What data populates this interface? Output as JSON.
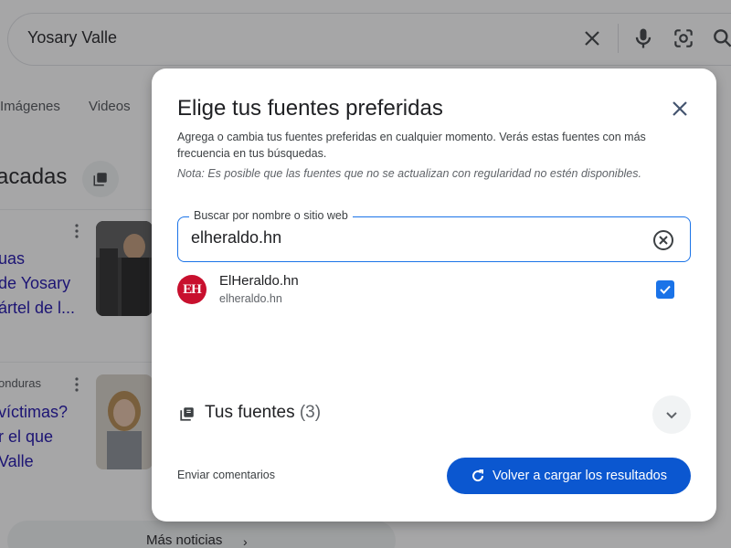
{
  "search": {
    "query": "Yosary Valle"
  },
  "background": {
    "tabs": [
      "Imágenes",
      "Videos"
    ],
    "heading": "acadas",
    "news1_lines": [
      "uas",
      "de Yosary",
      "ártel de l..."
    ],
    "news2_source": "onduras",
    "news2_lines": [
      "víctimas?",
      "r el que",
      "Valle"
    ],
    "more_news": "Más noticias"
  },
  "dialog": {
    "title": "Elige tus fuentes preferidas",
    "description": "Agrega o cambia tus fuentes preferidas en cualquier momento. Verás estas fuentes con más frecuencia en tus búsquedas.",
    "note": "Nota: Es posible que las fuentes que no se actualizan con regularidad no estén disponibles.",
    "search_field": {
      "label": "Buscar por nombre o sitio web",
      "value": "elheraldo.hn"
    },
    "result": {
      "logo_text": "EH",
      "name": "ElHeraldo.hn",
      "site": "elheraldo.hn",
      "checked": true
    },
    "your_sources": {
      "label": "Tus fuentes",
      "count": "(3)"
    },
    "feedback": "Enviar comentarios",
    "reload_button": "Volver a cargar los resultados"
  },
  "colors": {
    "accent": "#1a73e8",
    "primary_button": "#0b57d0",
    "brand_red": "#c8102e"
  },
  "icons": [
    "close-icon",
    "mic-icon",
    "lens-icon",
    "search-icon",
    "clear-icon",
    "checkbox-check-icon",
    "sources-icon",
    "chevron-down-icon",
    "refresh-icon"
  ]
}
